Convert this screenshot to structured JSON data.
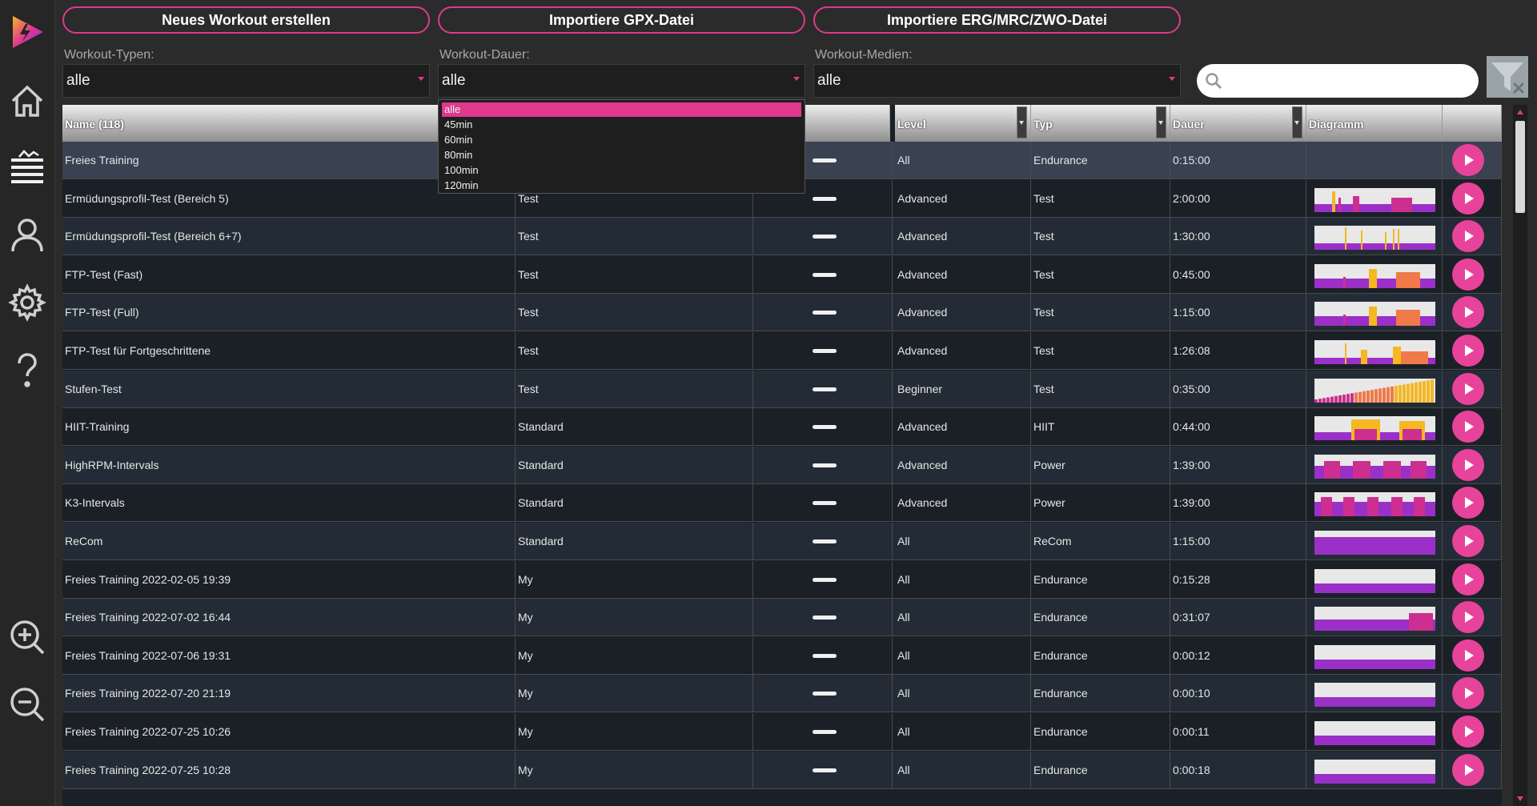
{
  "toolbar": {
    "new_workout": "Neues Workout erstellen",
    "import_gpx": "Importiere GPX-Datei",
    "import_erg": "Importiere ERG/MRC/ZWO-Datei"
  },
  "filters": {
    "types_label": "Workout-Typen:",
    "types_value": "alle",
    "duration_label": "Workout-Dauer:",
    "duration_value": "alle",
    "media_label": "Workout-Medien:",
    "media_value": "alle",
    "search_value": "",
    "duration_options": [
      "alle",
      "45min",
      "60min",
      "80min",
      "100min",
      "120min"
    ],
    "duration_selected_index": 0
  },
  "table": {
    "headers": {
      "name": "Name (118)",
      "level": "Level",
      "typ": "Typ",
      "dauer": "Dauer",
      "diagramm": "Diagramm"
    },
    "rows": [
      {
        "name": "Freies Training",
        "category": "",
        "level": "All",
        "typ": "Endurance",
        "dauer": "0:15:00",
        "diagram": "none"
      },
      {
        "name": "Ermüdungsprofil-Test (Bereich 5)",
        "category": "Test",
        "level": "Advanced",
        "typ": "Test",
        "dauer": "2:00:00",
        "diagram": "test5"
      },
      {
        "name": "Ermüdungsprofil-Test (Bereich 6+7)",
        "category": "Test",
        "level": "Advanced",
        "typ": "Test",
        "dauer": "1:30:00",
        "diagram": "test67"
      },
      {
        "name": "FTP-Test (Fast)",
        "category": "Test",
        "level": "Advanced",
        "typ": "Test",
        "dauer": "0:45:00",
        "diagram": "ftp"
      },
      {
        "name": "FTP-Test (Full)",
        "category": "Test",
        "level": "Advanced",
        "typ": "Test",
        "dauer": "1:15:00",
        "diagram": "ftp"
      },
      {
        "name": "FTP-Test für Fortgeschrittene",
        "category": "Test",
        "level": "Advanced",
        "typ": "Test",
        "dauer": "1:26:08",
        "diagram": "ftpadv"
      },
      {
        "name": "Stufen-Test",
        "category": "Test",
        "level": "Beginner",
        "typ": "Test",
        "dauer": "0:35:00",
        "diagram": "ramp"
      },
      {
        "name": "HIIT-Training",
        "category": "Standard",
        "level": "Advanced",
        "typ": "HIIT",
        "dauer": "0:44:00",
        "diagram": "hiit"
      },
      {
        "name": "HighRPM-Intervals",
        "category": "Standard",
        "level": "Advanced",
        "typ": "Power",
        "dauer": "1:39:00",
        "diagram": "power"
      },
      {
        "name": "K3-Intervals",
        "category": "Standard",
        "level": "Advanced",
        "typ": "Power",
        "dauer": "1:39:00",
        "diagram": "k3"
      },
      {
        "name": "ReCom",
        "category": "Standard",
        "level": "All",
        "typ": "ReCom",
        "dauer": "1:15:00",
        "diagram": "flat"
      },
      {
        "name": "Freies Training 2022-02-05 19:39",
        "category": "My",
        "level": "All",
        "typ": "Endurance",
        "dauer": "0:15:28",
        "diagram": "low"
      },
      {
        "name": "Freies Training 2022-07-02 16:44",
        "category": "My",
        "level": "All",
        "typ": "Endurance",
        "dauer": "0:31:07",
        "diagram": "endred"
      },
      {
        "name": "Freies Training 2022-07-06 19:31",
        "category": "My",
        "level": "All",
        "typ": "Endurance",
        "dauer": "0:00:12",
        "diagram": "low"
      },
      {
        "name": "Freies Training 2022-07-20 21:19",
        "category": "My",
        "level": "All",
        "typ": "Endurance",
        "dauer": "0:00:10",
        "diagram": "low"
      },
      {
        "name": "Freies Training 2022-07-25 10:26",
        "category": "My",
        "level": "All",
        "typ": "Endurance",
        "dauer": "0:00:11",
        "diagram": "low"
      },
      {
        "name": "Freies Training 2022-07-25 10:28",
        "category": "My",
        "level": "All",
        "typ": "Endurance",
        "dauer": "0:00:18",
        "diagram": "low"
      }
    ]
  },
  "colors": {
    "accent": "#e0388f",
    "diagram_purple": "#9b30c8",
    "diagram_magenta": "#cc2f8f",
    "diagram_orange": "#f07a4a",
    "diagram_yellow": "#f5b820"
  },
  "icons": [
    "app-logo-icon",
    "home-icon",
    "workout-list-icon",
    "user-icon",
    "settings-gear-icon",
    "help-icon",
    "zoom-in-icon",
    "zoom-out-icon",
    "search-icon",
    "filter-clear-icon",
    "play-icon"
  ]
}
